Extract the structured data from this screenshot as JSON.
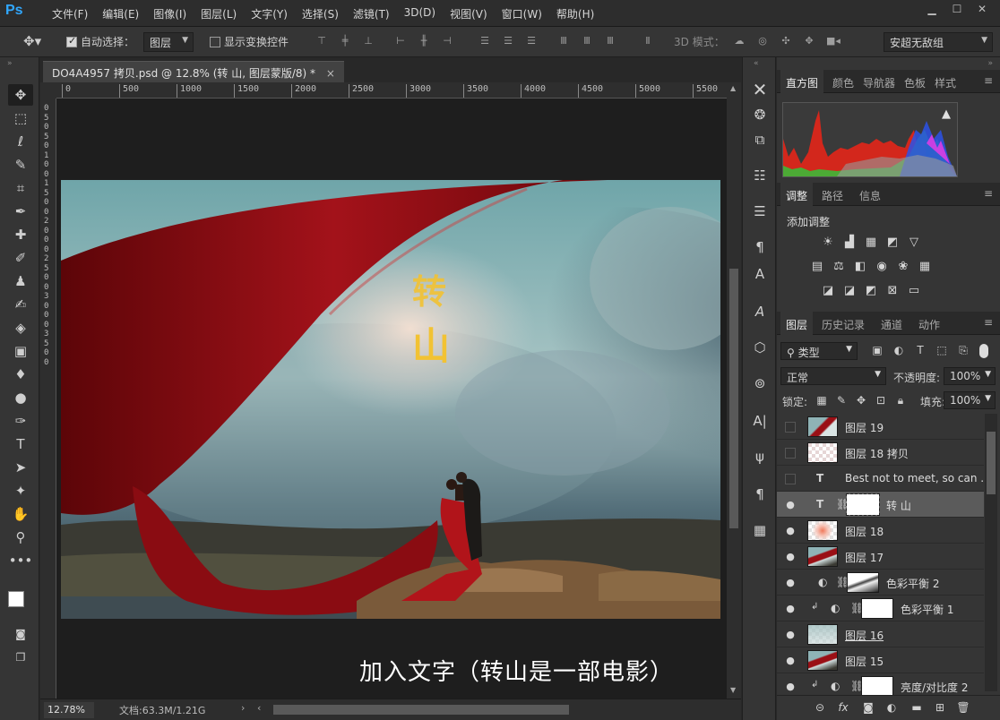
{
  "app": {
    "logo": "Ps"
  },
  "menu": [
    "文件(F)",
    "编辑(E)",
    "图像(I)",
    "图层(L)",
    "文字(Y)",
    "选择(S)",
    "滤镜(T)",
    "3D(D)",
    "视图(V)",
    "窗口(W)",
    "帮助(H)"
  ],
  "window_controls": {
    "minimize": "▁",
    "maximize": "☐",
    "close": "✕"
  },
  "options": {
    "auto_select_label": "自动选择：",
    "auto_select_checked": true,
    "auto_select_value": "图层",
    "show_transform_label": "显示变换控件",
    "show_transform_checked": false,
    "mode_3d_label": "3D 模式：",
    "workspace_value": "安超无敌组"
  },
  "document": {
    "tab_title": "DO4A4957 拷贝.psd @ 12.8% (转 山, 图层蒙版/8) *",
    "tab_close": "×",
    "ruler_marks": [
      "0",
      "500",
      "1000",
      "1500",
      "2000",
      "2500",
      "3000",
      "3500",
      "4000",
      "4500",
      "5000",
      "5500"
    ],
    "ruler_left_marks": [
      "0",
      "5",
      "0",
      "5",
      "0",
      "1",
      "0",
      "0",
      "1",
      "5",
      "0",
      "0",
      "2",
      "0",
      "0",
      "0",
      "2",
      "5",
      "0",
      "0",
      "3",
      "0",
      "0",
      "0",
      "3",
      "5",
      "0",
      "0"
    ],
    "artwork_title_top": "转",
    "artwork_title_bottom": "山",
    "caption": "加入文字（转山是一部电影）",
    "zoom": "12.78%",
    "info": "文档:63.3M/1.21G"
  },
  "panels": {
    "top_tabs": [
      "直方图",
      "颜色",
      "导航器",
      "色板",
      "样式"
    ],
    "adj_tabs": [
      "调整",
      "路径",
      "信息"
    ],
    "adj_title": "添加调整",
    "layer_tabs": [
      "图层",
      "历史记录",
      "通道",
      "动作"
    ],
    "filter_kind": "类型",
    "blend_mode": "正常",
    "opacity_label": "不透明度:",
    "opacity_value": "100%",
    "lock_label": "锁定:",
    "fill_label": "填充:",
    "fill_value": "100%"
  },
  "layers": [
    {
      "name": "图层 19",
      "visible": false,
      "thumb": "photo",
      "selected": false
    },
    {
      "name": "图层 18 拷贝",
      "visible": false,
      "thumb": "checker",
      "selected": false
    },
    {
      "name": "Best not to meet, so can ...",
      "visible": false,
      "thumb": "text",
      "selected": false
    },
    {
      "name": "转 山",
      "visible": true,
      "thumb": "text-mask",
      "selected": true
    },
    {
      "name": "图层 18",
      "visible": true,
      "thumb": "checker-red",
      "selected": false
    },
    {
      "name": "图层 17",
      "visible": true,
      "thumb": "photo",
      "selected": false
    },
    {
      "name": "色彩平衡 2",
      "visible": true,
      "thumb": "adj-mask-photo",
      "selected": false
    },
    {
      "name": "色彩平衡 1",
      "visible": true,
      "thumb": "adj-mask-white",
      "selected": false
    },
    {
      "name": "图层 16",
      "visible": true,
      "thumb": "checker-cloud",
      "selected": false
    },
    {
      "name": "图层 15",
      "visible": true,
      "thumb": "photo",
      "selected": false
    },
    {
      "name": "亮度/对比度 2",
      "visible": true,
      "thumb": "adj-mask-white",
      "selected": false
    }
  ],
  "colors": {
    "accent": "#31a8ff",
    "panel_bg": "#353535",
    "dark_bg": "#282828",
    "selected_row": "#5b5b5b",
    "chinese_title": "#f2c233",
    "silk_red": "#9b0d12"
  }
}
